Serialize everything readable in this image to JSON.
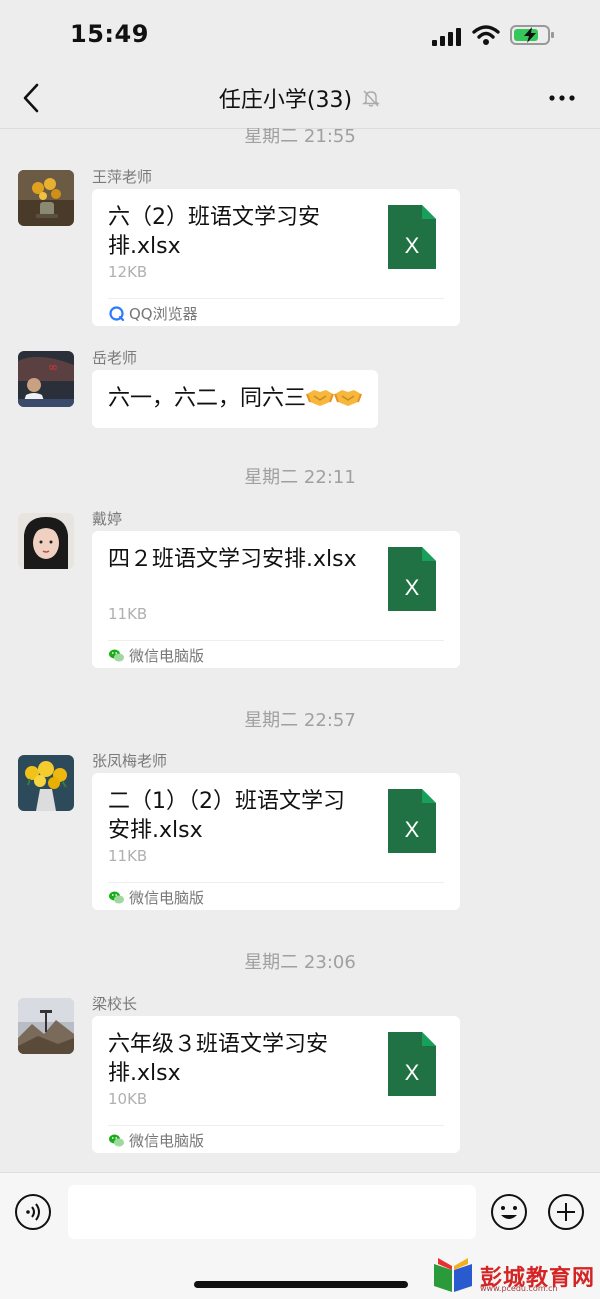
{
  "status_bar": {
    "time": "15:49"
  },
  "header": {
    "title": "任庄小学(33)",
    "muted": true
  },
  "messages": [
    {
      "timestamp": "星期二 21:55"
    },
    {
      "sender": "王萍老师",
      "type": "file",
      "file_name": "六（2）班语文学习安排.xlsx",
      "file_size": "12KB",
      "source": "QQ浏览器"
    },
    {
      "sender": "岳老师",
      "type": "text",
      "text": "六一，六二，同六三"
    },
    {
      "timestamp": "星期二 22:11"
    },
    {
      "sender": "戴婷",
      "type": "file",
      "file_name": "四２班语文学习安排.xlsx",
      "file_size": "11KB",
      "source": "微信电脑版"
    },
    {
      "timestamp": "星期二 22:57"
    },
    {
      "sender": "张凤梅老师",
      "type": "file",
      "file_name": "二（1）（2）班语文学习安排.xlsx",
      "file_size": "11KB",
      "source": "微信电脑版"
    },
    {
      "timestamp": "星期二 23:06"
    },
    {
      "sender": "梁校长",
      "type": "file",
      "file_name": "六年级３班语文学习安排.xlsx",
      "file_size": "10KB",
      "source": "微信电脑版"
    }
  ],
  "file_icon_letter": "X",
  "watermark": {
    "text": "彭城教育网",
    "sub": "www.pcedu.com.cn"
  },
  "colors": {
    "excel_green": "#207245",
    "background": "#ededed",
    "watermark_red": "#d42424"
  },
  "icons": [
    "back-arrow-icon",
    "mute-bell-icon",
    "more-dots-icon",
    "excel-file-icon",
    "qq-browser-icon",
    "wechat-pc-icon",
    "handshake-emoji-icon",
    "voice-icon",
    "emoji-icon",
    "plus-icon"
  ]
}
